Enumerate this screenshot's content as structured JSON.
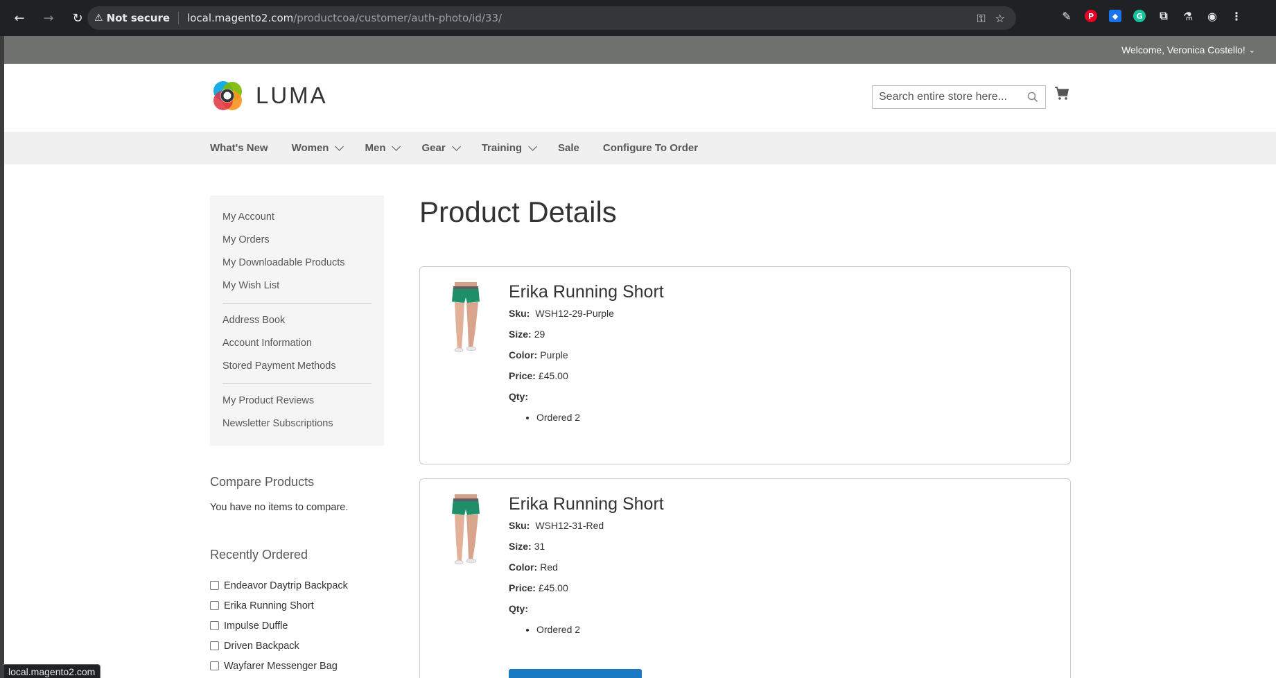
{
  "browser": {
    "security_label": "Not secure",
    "url_host": "local.magento2.com",
    "url_path": "/productcoa/customer/auth-photo/id/33/",
    "status_url": "local.magento2.com"
  },
  "header": {
    "welcome": "Welcome, Veronica Costello!",
    "logo_text": "LUMA",
    "search_placeholder": "Search entire store here..."
  },
  "nav": {
    "items": [
      {
        "label": "What's New",
        "dropdown": false
      },
      {
        "label": "Women",
        "dropdown": true
      },
      {
        "label": "Men",
        "dropdown": true
      },
      {
        "label": "Gear",
        "dropdown": true
      },
      {
        "label": "Training",
        "dropdown": true
      },
      {
        "label": "Sale",
        "dropdown": false
      },
      {
        "label": "Configure To Order",
        "dropdown": false
      }
    ]
  },
  "sidebar": {
    "account_links": [
      "My Account",
      "My Orders",
      "My Downloadable Products",
      "My Wish List",
      "Address Book",
      "Account Information",
      "Stored Payment Methods",
      "My Product Reviews",
      "Newsletter Subscriptions"
    ],
    "compare_title": "Compare Products",
    "compare_empty": "You have no items to compare.",
    "recent_title": "Recently Ordered",
    "recent_items": [
      "Endeavor Daytrip Backpack",
      "Erika Running Short",
      "Impulse Duffle",
      "Driven Backpack",
      "Wayfarer Messenger Bag"
    ]
  },
  "main": {
    "title": "Product Details",
    "labels": {
      "sku": "Sku:",
      "size": "Size:",
      "color": "Color:",
      "price": "Price:",
      "qty": "Qty:"
    },
    "products": [
      {
        "name": "Erika Running Short",
        "sku": "WSH12-29-Purple",
        "size": "29",
        "color": "Purple",
        "price": "£45.00",
        "qty": "Ordered 2"
      },
      {
        "name": "Erika Running Short",
        "sku": "WSH12-31-Red",
        "size": "31",
        "color": "Red",
        "price": "£45.00",
        "qty": "Ordered 2"
      }
    ]
  },
  "colors": {
    "panel_header": "#6e716e",
    "nav_bg": "#f0f0f0",
    "primary_button": "#1979c3"
  }
}
